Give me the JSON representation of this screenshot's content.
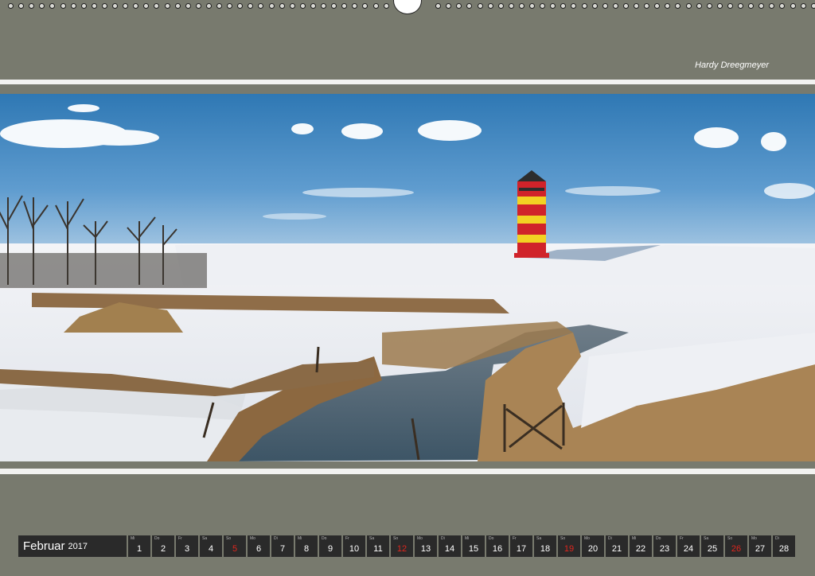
{
  "photographer": "Hardy Dreegmeyer",
  "photo": {
    "subject": "lighthouse"
  },
  "calendar": {
    "month": "Februar",
    "year": "2017",
    "days": [
      {
        "wd": "Mi",
        "n": "1",
        "sun": false
      },
      {
        "wd": "Do",
        "n": "2",
        "sun": false
      },
      {
        "wd": "Fr",
        "n": "3",
        "sun": false
      },
      {
        "wd": "Sa",
        "n": "4",
        "sun": false
      },
      {
        "wd": "So",
        "n": "5",
        "sun": true
      },
      {
        "wd": "Mo",
        "n": "6",
        "sun": false
      },
      {
        "wd": "Di",
        "n": "7",
        "sun": false
      },
      {
        "wd": "Mi",
        "n": "8",
        "sun": false
      },
      {
        "wd": "Do",
        "n": "9",
        "sun": false
      },
      {
        "wd": "Fr",
        "n": "10",
        "sun": false
      },
      {
        "wd": "Sa",
        "n": "11",
        "sun": false
      },
      {
        "wd": "So",
        "n": "12",
        "sun": true
      },
      {
        "wd": "Mo",
        "n": "13",
        "sun": false
      },
      {
        "wd": "Di",
        "n": "14",
        "sun": false
      },
      {
        "wd": "Mi",
        "n": "15",
        "sun": false
      },
      {
        "wd": "Do",
        "n": "16",
        "sun": false
      },
      {
        "wd": "Fr",
        "n": "17",
        "sun": false
      },
      {
        "wd": "Sa",
        "n": "18",
        "sun": false
      },
      {
        "wd": "So",
        "n": "19",
        "sun": true
      },
      {
        "wd": "Mo",
        "n": "20",
        "sun": false
      },
      {
        "wd": "Di",
        "n": "21",
        "sun": false
      },
      {
        "wd": "Mi",
        "n": "22",
        "sun": false
      },
      {
        "wd": "Do",
        "n": "23",
        "sun": false
      },
      {
        "wd": "Fr",
        "n": "24",
        "sun": false
      },
      {
        "wd": "Sa",
        "n": "25",
        "sun": false
      },
      {
        "wd": "So",
        "n": "26",
        "sun": true
      },
      {
        "wd": "Mo",
        "n": "27",
        "sun": false
      },
      {
        "wd": "Di",
        "n": "28",
        "sun": false
      }
    ]
  },
  "colors": {
    "frame": "#787a6e",
    "cell": "#2a2a2a",
    "sunday": "#e0261e"
  }
}
